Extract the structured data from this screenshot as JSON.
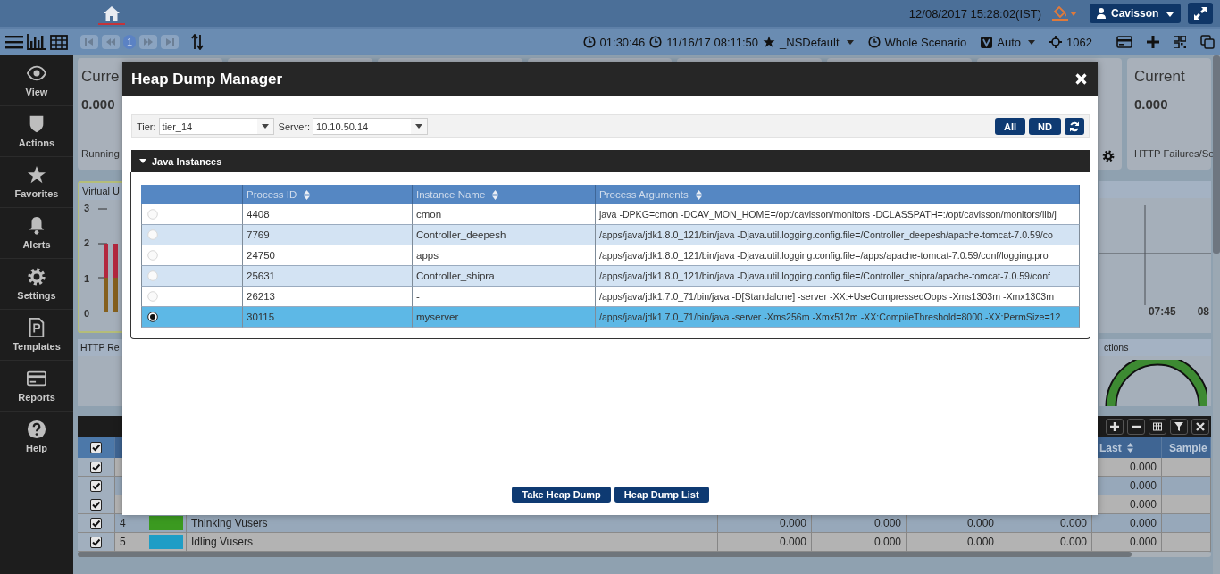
{
  "header": {
    "datetime": "12/08/2017 15:28:02(IST)",
    "user": "Cavisson"
  },
  "toolbar": {
    "page": "1",
    "elapsed": "01:30:46",
    "start_time": "11/16/17 08:11:50",
    "favorite": "_NSDefault",
    "range": "Whole Scenario",
    "mode": "Auto",
    "count": "1062"
  },
  "sidebar": {
    "items": [
      {
        "label": "View"
      },
      {
        "label": "Actions"
      },
      {
        "label": "Favorites"
      },
      {
        "label": "Alerts"
      },
      {
        "label": "Settings"
      },
      {
        "label": "Templates"
      },
      {
        "label": "Reports"
      },
      {
        "label": "Help"
      }
    ]
  },
  "dashboard": {
    "cards": [
      {
        "title": "Curre",
        "value": "0.000",
        "footer": "Running"
      },
      {
        "title": "Current",
        "value": "0.000",
        "footer": "HTTP Failures/Se"
      }
    ],
    "vusers_panel": {
      "title": "Virtual U",
      "y_labels": [
        "3",
        "2",
        "1",
        "0"
      ]
    },
    "trend_panel": {
      "x_labels": [
        "07:45",
        "08"
      ]
    },
    "requests_panel": {
      "title": "HTTP Re"
    },
    "connections_panel": {
      "title": "ctions"
    },
    "grid": {
      "header_checked": true,
      "columns": [
        "Last",
        "Sample"
      ],
      "rows": [
        {
          "checked": true,
          "values": [
            "0.000"
          ]
        },
        {
          "checked": true,
          "values": [
            "0.000"
          ]
        },
        {
          "checked": true,
          "values": [
            "0.000"
          ]
        },
        {
          "checked": true,
          "number": "4",
          "color": "#3b9a20",
          "name": "Thinking Vusers",
          "values": [
            "0.000",
            "0.000",
            "0.000",
            "0.000",
            "0.000"
          ]
        },
        {
          "checked": true,
          "number": "5",
          "color": "#1e9dc6",
          "name": "Idling Vusers",
          "values": [
            "0.000",
            "0.000",
            "0.000",
            "0.000",
            "0.000"
          ]
        }
      ]
    }
  },
  "dialog": {
    "title": "Heap Dump Manager",
    "tier_label": "Tier:",
    "tier": "tier_14",
    "server_label": "Server:",
    "server": "10.10.50.14",
    "filter_buttons": [
      "All",
      "ND"
    ],
    "section": {
      "title": "Java Instances",
      "expanded": true
    },
    "columns": [
      "Process ID",
      "Instance Name",
      "Process Arguments"
    ],
    "rows": [
      {
        "selected": false,
        "pid": "4408",
        "name": "cmon",
        "args": "java -DPKG=cmon -DCAV_MON_HOME=/opt/cavisson/monitors -DCLASSPATH=:/opt/cavisson/monitors/lib/j"
      },
      {
        "selected": false,
        "pid": "7769",
        "name": "Controller_deepesh",
        "args": "/apps/java/jdk1.8.0_121/bin/java -Djava.util.logging.config.file=/Controller_deepesh/apache-tomcat-7.0.59/co"
      },
      {
        "selected": false,
        "pid": "24750",
        "name": "apps",
        "args": "/apps/java/jdk1.8.0_121/bin/java -Djava.util.logging.config.file=/apps/apache-tomcat-7.0.59/conf/logging.pro"
      },
      {
        "selected": false,
        "pid": "25631",
        "name": "Controller_shipra",
        "args": "/apps/java/jdk1.8.0_121/bin/java -Djava.util.logging.config.file=/Controller_shipra/apache-tomcat-7.0.59/conf"
      },
      {
        "selected": false,
        "pid": "26213",
        "name": "-",
        "args": "/apps/java/jdk1.7.0_71/bin/java -D[Standalone] -server -XX:+UseCompressedOops -Xms1303m -Xmx1303m"
      },
      {
        "selected": true,
        "pid": "30115",
        "name": "myserver",
        "args": "/apps/java/jdk1.7.0_71/bin/java -server -Xms256m -Xmx512m -XX:CompileThreshold=8000 -XX:PermSize=12"
      }
    ],
    "actions": [
      "Take Heap Dump",
      "Heap Dump List"
    ]
  }
}
